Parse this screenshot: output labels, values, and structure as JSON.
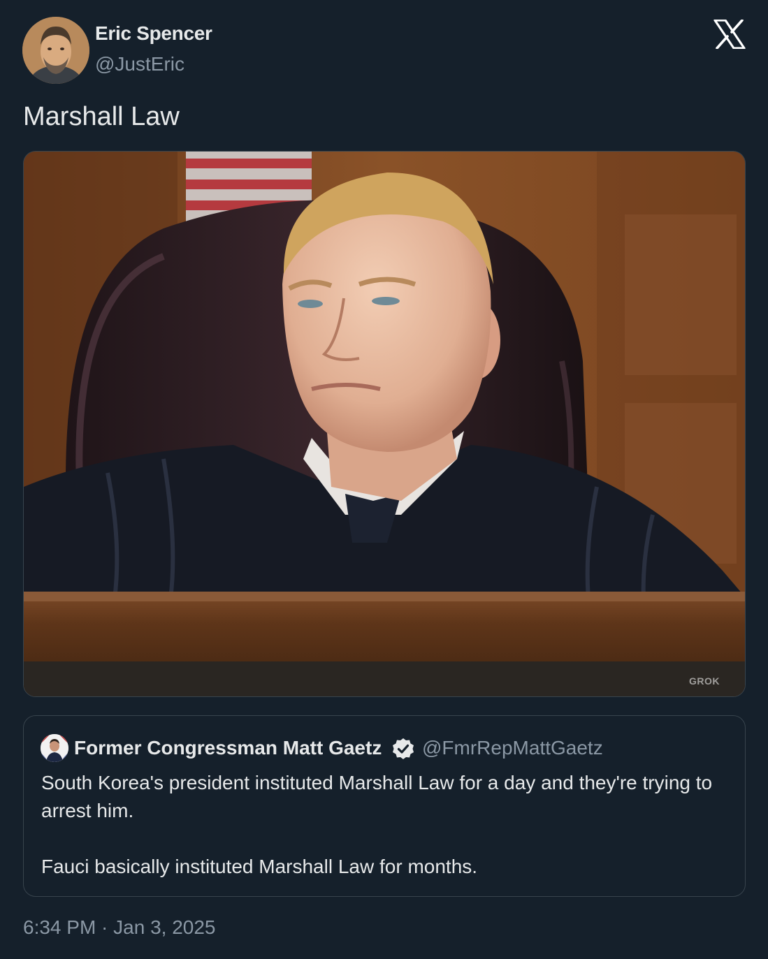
{
  "author": {
    "display_name": "Eric Spencer",
    "handle": "@JustEric",
    "avatar_icon": "profile-photo"
  },
  "platform_logo": "x-logo-icon",
  "tweet": {
    "text": "Marshall Law",
    "media": {
      "kind": "photo",
      "watermark": "GROK"
    },
    "timestamp": "6:34 PM · Jan 3, 2025"
  },
  "quoted_tweet": {
    "display_name": "Former Congressman Matt Gaetz",
    "verified": true,
    "handle": "@FmrRepMattGaetz",
    "paragraphs": [
      "South Korea's president instituted Marshall Law for a day and they're trying to arrest him.",
      "Fauci basically instituted Marshall Law for months."
    ]
  },
  "colors": {
    "background": "#15202b",
    "primary_text": "#e7e9ea",
    "secondary_text": "#8b98a5",
    "border": "#38444d"
  }
}
